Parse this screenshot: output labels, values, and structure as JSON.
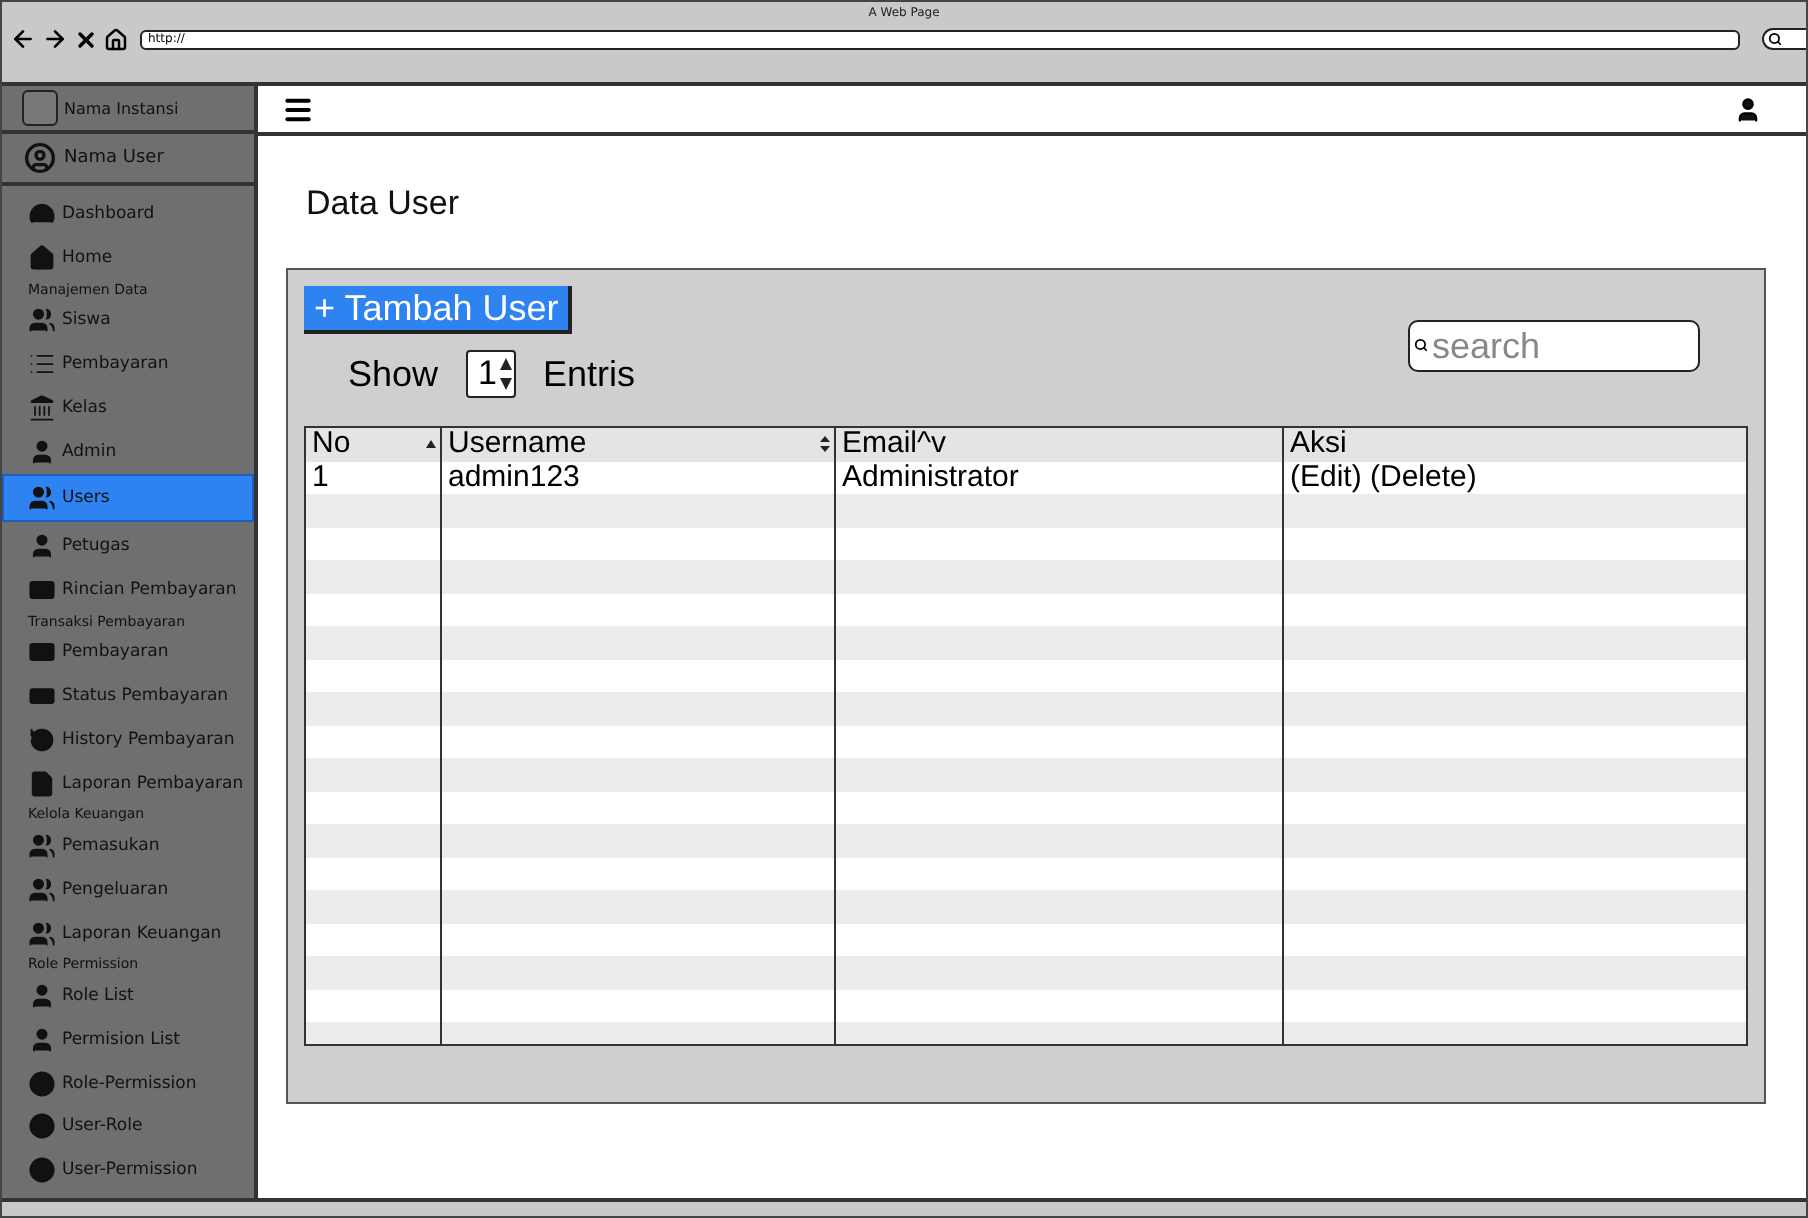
{
  "window": {
    "title": "A Web Page",
    "url": "http://"
  },
  "sidebar": {
    "brand": "Nama Instansi",
    "user": "Nama User",
    "items": [
      {
        "kind": "item",
        "label": "Dashboard",
        "selected": false
      },
      {
        "kind": "item",
        "label": "Home",
        "selected": false
      },
      {
        "kind": "section",
        "label": "Manajemen Data"
      },
      {
        "kind": "item",
        "label": "Siswa",
        "selected": false
      },
      {
        "kind": "item",
        "label": "Pembayaran",
        "selected": false
      },
      {
        "kind": "item",
        "label": "Kelas",
        "selected": false
      },
      {
        "kind": "item",
        "label": "Admin",
        "selected": false
      },
      {
        "kind": "item",
        "label": "Users",
        "selected": true
      },
      {
        "kind": "item",
        "label": "Petugas",
        "selected": false
      },
      {
        "kind": "item",
        "label": "Rincian Pembayaran",
        "selected": false
      },
      {
        "kind": "section",
        "label": "Transaksi Pembayaran"
      },
      {
        "kind": "item",
        "label": "Pembayaran",
        "selected": false
      },
      {
        "kind": "item",
        "label": "Status Pembayaran",
        "selected": false
      },
      {
        "kind": "item",
        "label": "History Pembayaran",
        "selected": false
      },
      {
        "kind": "item",
        "label": "Laporan Pembayaran",
        "selected": false
      },
      {
        "kind": "section",
        "label": "Kelola Keuangan"
      },
      {
        "kind": "item",
        "label": "Pemasukan",
        "selected": false
      },
      {
        "kind": "item",
        "label": "Pengeluaran",
        "selected": false
      },
      {
        "kind": "item",
        "label": "Laporan Keuangan",
        "selected": false
      },
      {
        "kind": "section",
        "label": "Role Permission"
      },
      {
        "kind": "item",
        "label": "Role List",
        "selected": false
      },
      {
        "kind": "item",
        "label": "Permision List",
        "selected": false
      },
      {
        "kind": "item",
        "label": "Role-Permission",
        "selected": false
      },
      {
        "kind": "item",
        "label": "User-Role",
        "selected": false
      },
      {
        "kind": "item",
        "label": "User-Permission",
        "selected": false
      }
    ]
  },
  "page": {
    "title": "Data User",
    "add_button": "+ Tambah User",
    "show_label": "Show",
    "show_value": "1",
    "entries_label": "Entris",
    "search": {
      "placeholder": "search"
    }
  },
  "table": {
    "columns": [
      {
        "label": "No",
        "kind": "sorted"
      },
      {
        "label": "Username",
        "kind": "sortable"
      },
      {
        "label": "Email^v",
        "kind": "plain"
      },
      {
        "label": "Aksi",
        "kind": "plain"
      }
    ],
    "rows": [
      [
        "1",
        "admin123",
        "Administrator",
        "(Edit) (Delete)"
      ]
    ]
  }
}
